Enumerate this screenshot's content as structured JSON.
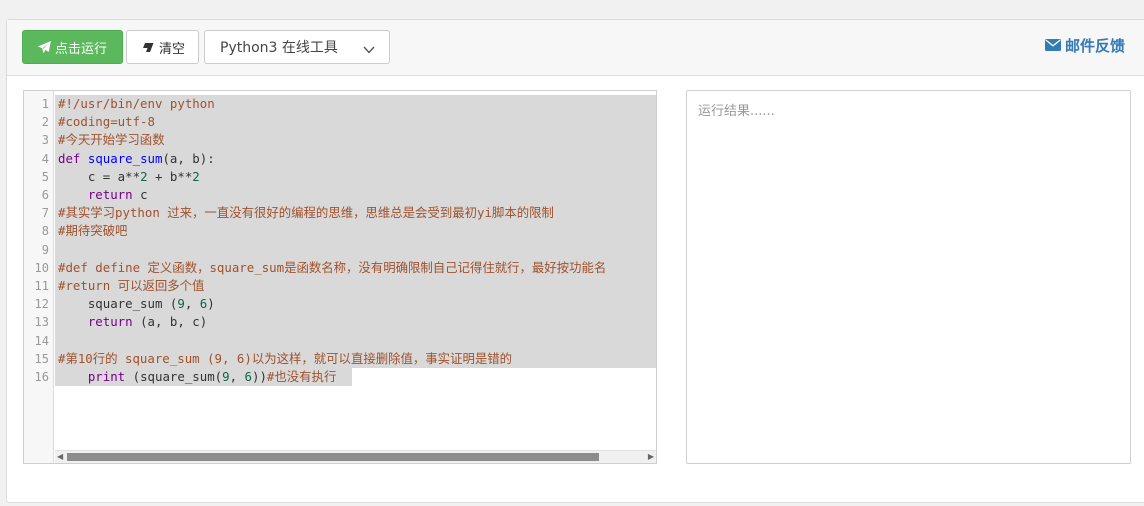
{
  "toolbar": {
    "run_label": "点击运行",
    "clear_label": "清空",
    "language_select": "Python3 在线工具",
    "feedback_label": "邮件反馈"
  },
  "editor": {
    "line_numbers": [
      "1",
      "2",
      "3",
      "4",
      "5",
      "6",
      "7",
      "8",
      "9",
      "10",
      "11",
      "12",
      "13",
      "14",
      "15",
      "16"
    ],
    "lines": [
      "#!/usr/bin/env python",
      "#coding=utf-8",
      "#今天开始学习函数",
      "def square_sum(a, b):",
      "    c = a**2 + b**2",
      "    return c",
      "#其实学习python 过来，一直没有很好的编程的思维，思维总是会受到最初yi脚本的限制",
      "#期待突破吧",
      "",
      "#def define 定义函数，square_sum是函数名称，没有明确限制自己记得住就行，最好按功能名",
      "#return 可以返回多个值",
      "    square_sum (9, 6)",
      "    return (a, b, c)",
      "",
      "#第10行的 square_sum (9, 6)以为这样，就可以直接删除值，事实证明是错的",
      "    print (square_sum(9, 6))#也没有执行"
    ]
  },
  "result": {
    "placeholder": "运行结果......"
  },
  "colors": {
    "run_button": "#5cb85c",
    "link": "#337ab7",
    "comment": "#a0522d",
    "keyword": "#770088",
    "function_name": "#0000ff",
    "number": "#116644",
    "selection": "#d9d9d9"
  }
}
